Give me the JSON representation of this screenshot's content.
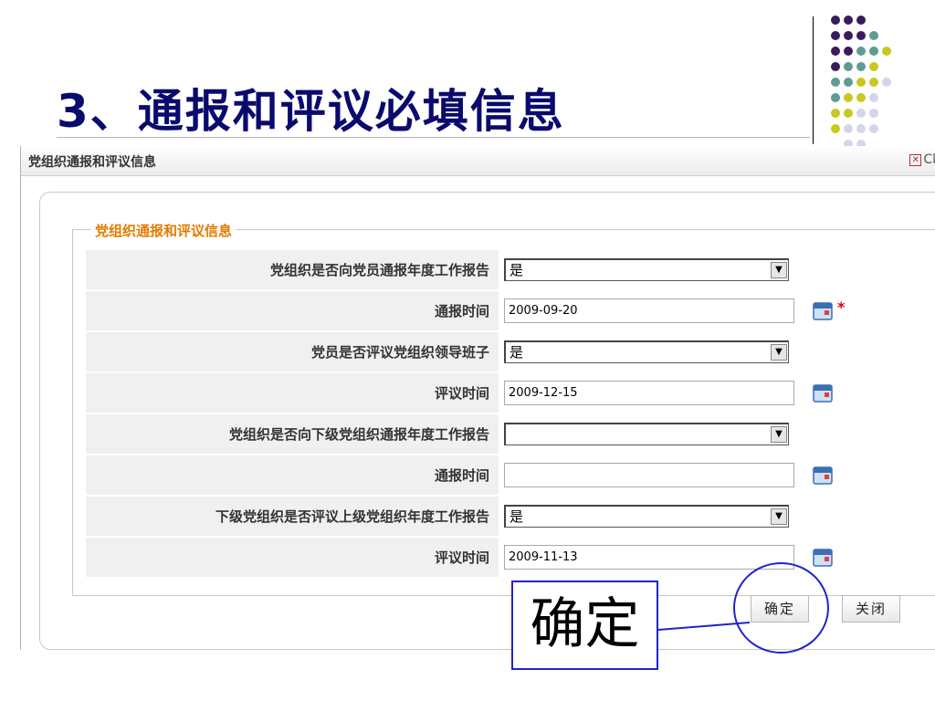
{
  "slide": {
    "title": "3、通报和评议必填信息",
    "callout_text": "确定"
  },
  "dialog": {
    "title": "党组织通报和评议信息",
    "close_label": "Cl",
    "legend": "党组织通报和评议信息",
    "rows": [
      {
        "label": "党组织是否向党员通报年度工作报告",
        "type": "select",
        "value": "是"
      },
      {
        "label": "通报时间",
        "type": "date",
        "value": "2009-09-20",
        "required": "*"
      },
      {
        "label": "党员是否评议党组织领导班子",
        "type": "select",
        "value": "是"
      },
      {
        "label": "评议时间",
        "type": "date",
        "value": "2009-12-15"
      },
      {
        "label": "党组织是否向下级党组织通报年度工作报告",
        "type": "select",
        "value": ""
      },
      {
        "label": "通报时间",
        "type": "date",
        "value": ""
      },
      {
        "label": "下级党组织是否评议上级党组织年度工作报告",
        "type": "select",
        "value": "是"
      },
      {
        "label": "评议时间",
        "type": "date",
        "value": "2009-11-13"
      }
    ],
    "buttons": {
      "confirm": "确定",
      "close": "关闭"
    }
  },
  "colors": {
    "title": "#0a0a6e",
    "legend": "#e57a00",
    "callout": "#2222cc",
    "required": "#e00000",
    "dot_purple": "#3b1c5a",
    "dot_teal": "#5f9b95",
    "dot_yellow": "#c8c81e",
    "dot_lilac": "#d4d4ec"
  },
  "icons": [
    "close-icon",
    "calendar-icon",
    "dropdown-arrow-icon"
  ]
}
